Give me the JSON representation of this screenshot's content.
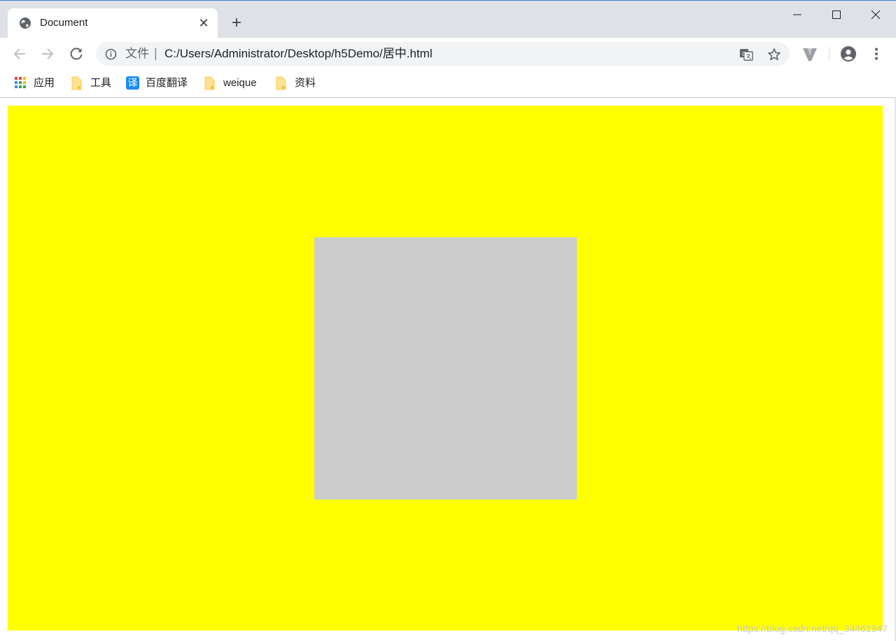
{
  "browser": {
    "tab": {
      "title": "Document",
      "close_glyph": "✕",
      "favicon": "globe-icon"
    },
    "new_tab_glyph": "+",
    "window_controls": [
      "minimize-icon",
      "maximize-icon",
      "close-icon"
    ]
  },
  "toolbar": {
    "omnibox": {
      "scheme_label": "文件",
      "separator": "|",
      "url": "C:/Users/Administrator/Desktop/h5Demo/居中.html"
    }
  },
  "bookmarks": [
    {
      "label": "应用",
      "icon": "apps-grid-icon"
    },
    {
      "label": "工具",
      "icon": "folder-icon"
    },
    {
      "label": "百度翻译",
      "icon": "translate-badge-icon",
      "badge": "译"
    },
    {
      "label": "weique",
      "icon": "folder-icon"
    },
    {
      "label": "资料",
      "icon": "folder-icon"
    }
  ],
  "page": {
    "outer_color": "#ffff00",
    "inner_color": "#cccccc",
    "watermark": "https://blog.csdn.net/qq_34461947"
  }
}
